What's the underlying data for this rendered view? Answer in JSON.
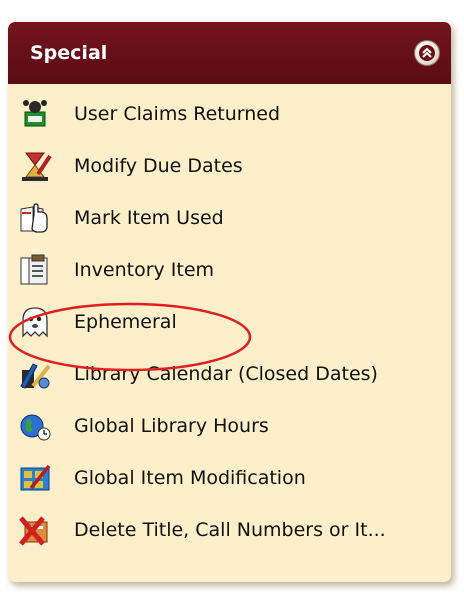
{
  "panel": {
    "title": "Special",
    "collapse_icon": "double-chevron-up-icon",
    "accent_color": "#6b101a",
    "background_color": "#fcefc9"
  },
  "items": [
    {
      "label": "User Claims Returned",
      "icon": "claims-returned-icon"
    },
    {
      "label": "Modify Due Dates",
      "icon": "due-date-icon"
    },
    {
      "label": "Mark Item Used",
      "icon": "hand-book-icon"
    },
    {
      "label": "Inventory Item",
      "icon": "inventory-book-icon"
    },
    {
      "label": "Ephemeral",
      "icon": "ghost-icon"
    },
    {
      "label": "Library Calendar (Closed Dates)",
      "icon": "calendar-icon"
    },
    {
      "label": "Global Library Hours",
      "icon": "globe-clock-icon"
    },
    {
      "label": "Global Item Modification",
      "icon": "global-modify-icon"
    },
    {
      "label": "Delete Title, Call Numbers or It...",
      "icon": "delete-icon"
    }
  ],
  "annotation": {
    "highlighted_item": "Ephemeral",
    "color": "#e02020"
  }
}
